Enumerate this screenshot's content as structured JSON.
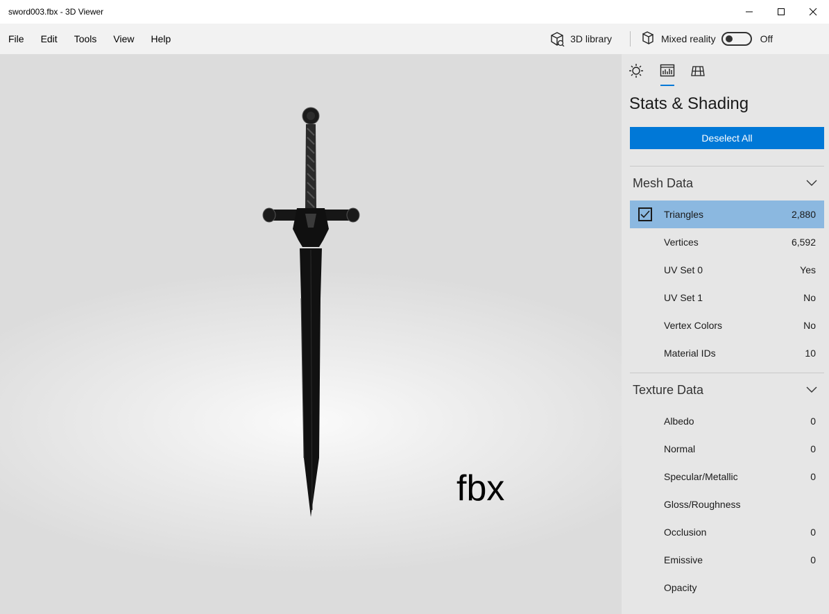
{
  "window": {
    "title": "sword003.fbx - 3D Viewer",
    "controls": [
      "minimize-icon",
      "maximize-icon",
      "close-icon"
    ]
  },
  "menu": {
    "items": [
      "File",
      "Edit",
      "Tools",
      "View",
      "Help"
    ],
    "library_label": "3D library",
    "mixed_reality_label": "Mixed reality",
    "mixed_reality_state": "Off"
  },
  "viewport": {
    "overlay_text": "fbx",
    "model": "sword"
  },
  "panel": {
    "tabs": [
      "lighting-icon",
      "stats-icon",
      "grid-icon"
    ],
    "active_tab": "stats-icon",
    "title": "Stats & Shading",
    "deselect_label": "Deselect All",
    "mesh_section": {
      "label": "Mesh Data",
      "rows": [
        {
          "name": "Triangles",
          "value": "2,880",
          "checked": true
        },
        {
          "name": "Vertices",
          "value": "6,592"
        },
        {
          "name": "UV Set 0",
          "value": "Yes"
        },
        {
          "name": "UV Set 1",
          "value": "No"
        },
        {
          "name": "Vertex Colors",
          "value": "No"
        },
        {
          "name": "Material IDs",
          "value": "10"
        }
      ]
    },
    "texture_section": {
      "label": "Texture Data",
      "rows": [
        {
          "name": "Albedo",
          "value": "0"
        },
        {
          "name": "Normal",
          "value": "0"
        },
        {
          "name": "Specular/Metallic",
          "value": "0"
        },
        {
          "name": "Gloss/Roughness",
          "value": ""
        },
        {
          "name": "Occlusion",
          "value": "0"
        },
        {
          "name": "Emissive",
          "value": "0"
        },
        {
          "name": "Opacity",
          "value": ""
        }
      ]
    }
  },
  "colors": {
    "accent": "#0078d7",
    "selected_row": "#8bb8e0",
    "panel_bg": "#e6e6e6",
    "menubar_bg": "#f2f2f2"
  }
}
